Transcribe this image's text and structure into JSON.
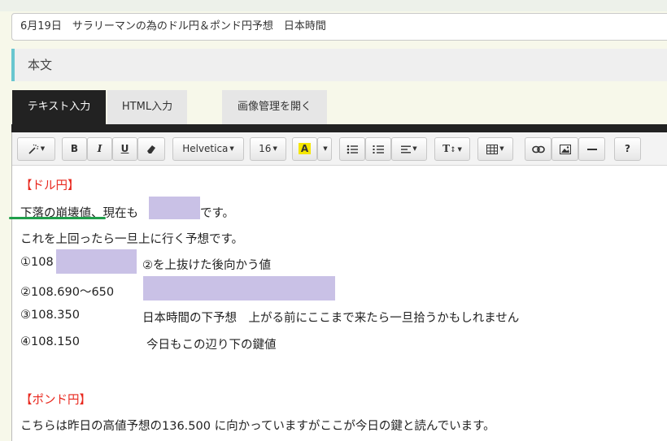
{
  "title_value": "6月19日　サラリーマンの為のドル円＆ポンド円予想　日本時間",
  "section_label": "本文",
  "tabs": {
    "text_input": "テキスト入力",
    "html_input": "HTML入力",
    "image_manager": "画像管理を開く"
  },
  "toolbar": {
    "bold": "B",
    "italic": "I",
    "underline": "U",
    "font_name": "Helvetica",
    "font_size": "16",
    "highlight": "A",
    "text_height": "T",
    "help": "?",
    "icons": [
      "magic-wand-icon",
      "eraser-icon",
      "caret-icon",
      "bullet-list-icon",
      "numbered-list-icon",
      "align-icon",
      "table-icon",
      "link-icon",
      "image-icon",
      "horizontal-rule-icon"
    ]
  },
  "content": {
    "heading_dollar": "【ドル円】",
    "line1_a": "下落の崩壊値、現在も",
    "line1_b": "です。",
    "line2": "これを上回ったら一旦上に行く予想です。",
    "line3_a": "①108",
    "line3_b": "②を上抜けた後向かう値",
    "line4": "②108.690～650",
    "line5_a": "③108.350",
    "line5_b": "日本時間の下予想　上がる前にここまで来たら一旦拾うかもしれません",
    "line6_a": "④108.150",
    "line6_b": "今日もこの辺り下の鍵値",
    "heading_pound": "【ポンド円】",
    "line7": "こちらは昨日の高値予想の136.500 に向かっていますがここが今日の鍵と読んでいます。"
  },
  "colors": {
    "accent_bar": "#69c6cf",
    "heading_red": "#e8281e",
    "mask": "#c9c1e6",
    "green_underline": "#1f9e4a",
    "highlight_yellow": "#f5e600"
  }
}
